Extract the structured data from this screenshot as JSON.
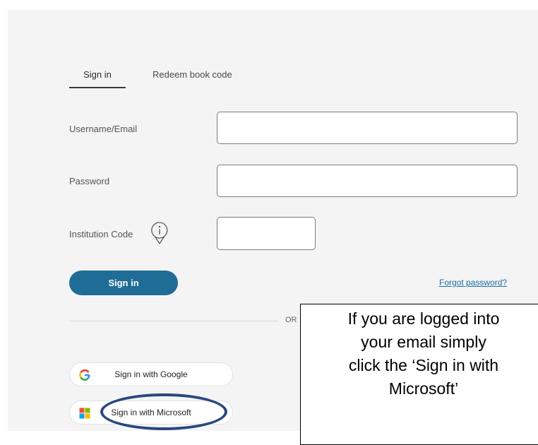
{
  "tabs": {
    "sign_in": "Sign in",
    "redeem": "Redeem book code"
  },
  "form": {
    "username_label": "Username/Email",
    "username_value": "",
    "password_label": "Password",
    "password_value": "",
    "institution_label": "Institution Code",
    "institution_value": "",
    "info_icon": "info-icon"
  },
  "actions": {
    "sign_in_label": "Sign in",
    "forgot_label": "Forgot password?",
    "or_label": "OR"
  },
  "social": {
    "google_label": "Sign in with Google",
    "google_icon": "google-logo",
    "microsoft_label": "Sign in with Microsoft",
    "microsoft_icon": "microsoft-logo"
  },
  "callout": {
    "lines": [
      "If you are logged into",
      "your email simply",
      "click the ‘Sign in with",
      "Microsoft’"
    ]
  },
  "colors": {
    "primary": "#1f6d96",
    "link": "#1a6ea0",
    "panel_bg": "#f4f4f5",
    "highlight_ring": "#28477e",
    "google_blue": "#4285F4",
    "google_red": "#EA4335",
    "google_yellow": "#FBBC05",
    "google_green": "#34A853",
    "ms_red": "#F25022",
    "ms_green": "#7FBA00",
    "ms_blue": "#00A4EF",
    "ms_yellow": "#FFB900"
  }
}
